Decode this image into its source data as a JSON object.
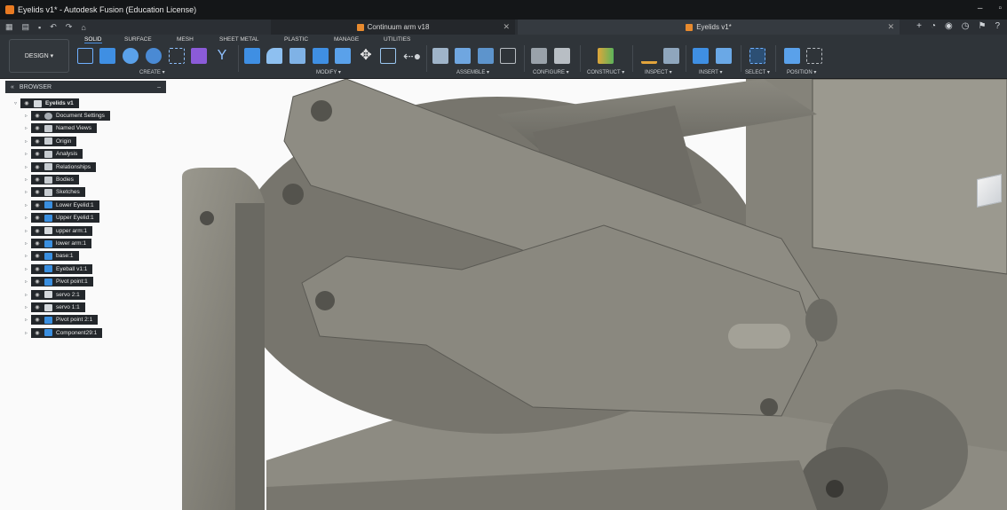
{
  "window": {
    "title": "Eyelids v1* - Autodesk Fusion (Education License)",
    "controls": [
      "–",
      "▫"
    ]
  },
  "tabs": [
    {
      "label": "Continuum arm v18",
      "active": false
    },
    {
      "label": "Eyelids v1*",
      "active": true
    }
  ],
  "ribbon": {
    "workspace": "DESIGN",
    "tabs": [
      "SOLID",
      "SURFACE",
      "MESH",
      "SHEET METAL",
      "PLASTIC",
      "MANAGE",
      "UTILITIES"
    ],
    "active_tab": "SOLID",
    "groups": [
      "CREATE",
      "MODIFY",
      "ASSEMBLE",
      "CONFIGURE",
      "CONSTRUCT",
      "INSPECT",
      "INSERT",
      "SELECT",
      "POSITION"
    ]
  },
  "browser": {
    "title": "BROWSER",
    "root": "Eyelids v1",
    "items": [
      {
        "label": "Document Settings",
        "icon": "gear-icon"
      },
      {
        "label": "Named Views",
        "icon": "folder-icon"
      },
      {
        "label": "Origin",
        "icon": "folder-icon"
      },
      {
        "label": "Analysis",
        "icon": "folder-icon"
      },
      {
        "label": "Relationships",
        "icon": "folder-icon"
      },
      {
        "label": "Bodies",
        "icon": "folder-icon"
      },
      {
        "label": "Sketches",
        "icon": "folder-icon"
      },
      {
        "label": "Lower Eyelid:1",
        "icon": "body-icon"
      },
      {
        "label": "Upper Eyelid:1",
        "icon": "body-icon"
      },
      {
        "label": "upper arm:1",
        "icon": "component-icon"
      },
      {
        "label": "lower arm:1",
        "icon": "body-icon"
      },
      {
        "label": "base:1",
        "icon": "body-icon"
      },
      {
        "label": "Eyeball v1:1",
        "icon": "body-icon"
      },
      {
        "label": "Pivot point:1",
        "icon": "body-icon"
      },
      {
        "label": "servo 2:1",
        "icon": "component-icon"
      },
      {
        "label": "servo 1:1",
        "icon": "component-icon"
      },
      {
        "label": "Pivot point 2:1",
        "icon": "body-icon"
      },
      {
        "label": "Component29:1",
        "icon": "body-icon"
      }
    ]
  },
  "colors": {
    "accent": "#4a90e2",
    "part": "#7d7b72",
    "part_dark": "#5e5d57",
    "part_light": "#9a988e"
  }
}
